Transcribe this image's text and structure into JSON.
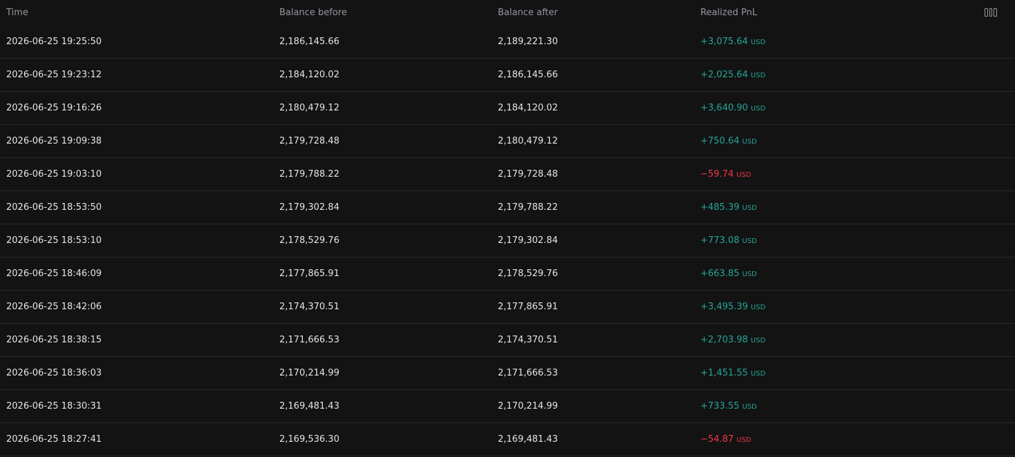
{
  "columns": {
    "time": "Time",
    "balance_before": "Balance before",
    "balance_after": "Balance after",
    "realized_pnl": "Realized PnL"
  },
  "colors": {
    "positive": "#26a69a",
    "negative": "#f23645"
  },
  "rows": [
    {
      "time": "2026-06-25 19:25:50",
      "before": "2,186,145.66",
      "after": "2,189,221.30",
      "pnl": "+3,075.64",
      "ccy": "USD",
      "sign": "pos"
    },
    {
      "time": "2026-06-25 19:23:12",
      "before": "2,184,120.02",
      "after": "2,186,145.66",
      "pnl": "+2,025.64",
      "ccy": "USD",
      "sign": "pos"
    },
    {
      "time": "2026-06-25 19:16:26",
      "before": "2,180,479.12",
      "after": "2,184,120.02",
      "pnl": "+3,640.90",
      "ccy": "USD",
      "sign": "pos"
    },
    {
      "time": "2026-06-25 19:09:38",
      "before": "2,179,728.48",
      "after": "2,180,479.12",
      "pnl": "+750.64",
      "ccy": "USD",
      "sign": "pos"
    },
    {
      "time": "2026-06-25 19:03:10",
      "before": "2,179,788.22",
      "after": "2,179,728.48",
      "pnl": "−59.74",
      "ccy": "USD",
      "sign": "neg"
    },
    {
      "time": "2026-06-25 18:53:50",
      "before": "2,179,302.84",
      "after": "2,179,788.22",
      "pnl": "+485.39",
      "ccy": "USD",
      "sign": "pos"
    },
    {
      "time": "2026-06-25 18:53:10",
      "before": "2,178,529.76",
      "after": "2,179,302.84",
      "pnl": "+773.08",
      "ccy": "USD",
      "sign": "pos"
    },
    {
      "time": "2026-06-25 18:46:09",
      "before": "2,177,865.91",
      "after": "2,178,529.76",
      "pnl": "+663.85",
      "ccy": "USD",
      "sign": "pos"
    },
    {
      "time": "2026-06-25 18:42:06",
      "before": "2,174,370.51",
      "after": "2,177,865.91",
      "pnl": "+3,495.39",
      "ccy": "USD",
      "sign": "pos"
    },
    {
      "time": "2026-06-25 18:38:15",
      "before": "2,171,666.53",
      "after": "2,174,370.51",
      "pnl": "+2,703.98",
      "ccy": "USD",
      "sign": "pos"
    },
    {
      "time": "2026-06-25 18:36:03",
      "before": "2,170,214.99",
      "after": "2,171,666.53",
      "pnl": "+1,451.55",
      "ccy": "USD",
      "sign": "pos"
    },
    {
      "time": "2026-06-25 18:30:31",
      "before": "2,169,481.43",
      "after": "2,170,214.99",
      "pnl": "+733.55",
      "ccy": "USD",
      "sign": "pos"
    },
    {
      "time": "2026-06-25 18:27:41",
      "before": "2,169,536.30",
      "after": "2,169,481.43",
      "pnl": "−54.87",
      "ccy": "USD",
      "sign": "neg"
    }
  ]
}
